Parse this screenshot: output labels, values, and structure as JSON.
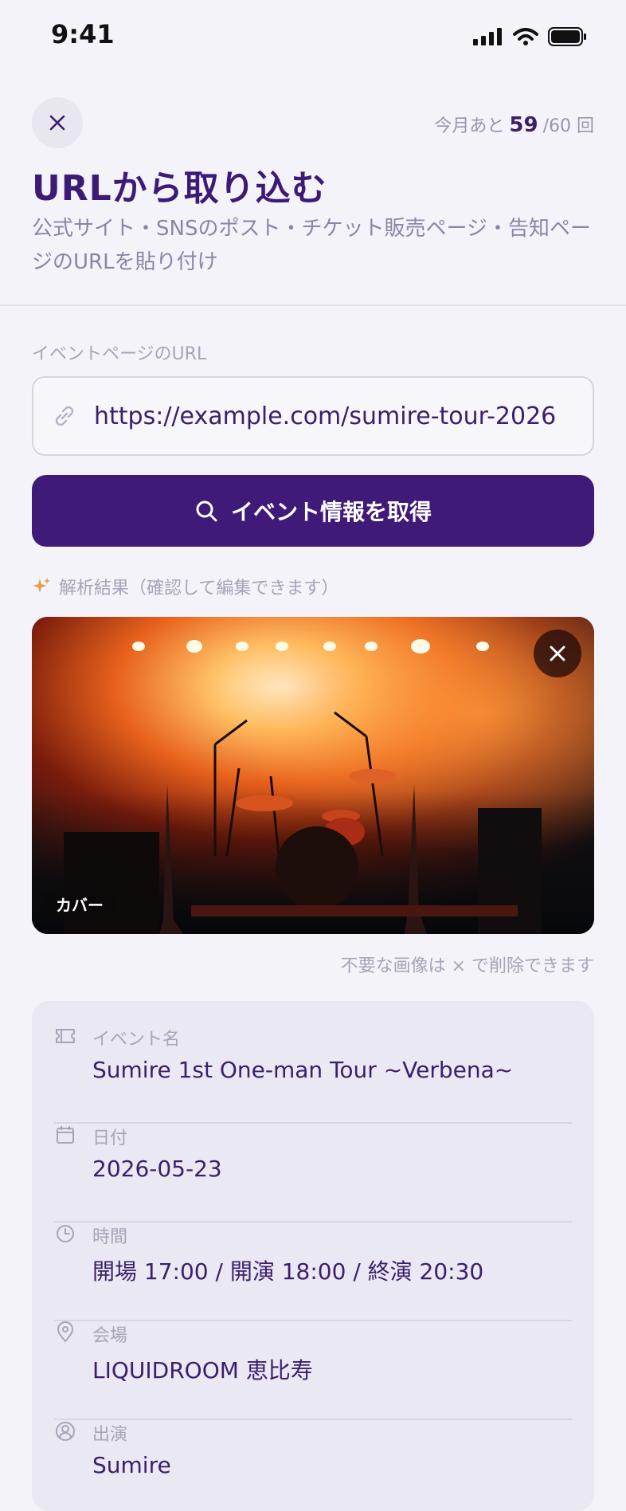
{
  "status_bar": {
    "time": "9:41"
  },
  "header": {
    "quota_prefix": "今月あと",
    "quota_remaining": "59",
    "quota_suffix": "/60 回",
    "title": "URLから取り込む",
    "subtitle": "公式サイト・SNSのポスト・チケット販売ページ・告知ページのURLを貼り付け"
  },
  "url_field": {
    "label": "イベントページのURL",
    "value": "https://example.com/sumire-tour-2026",
    "icon": "link-icon"
  },
  "fetch_button": {
    "label": "イベント情報を取得",
    "icon": "search-icon"
  },
  "result": {
    "label": "解析結果（確認して編集できます）",
    "image_badge": "カバー",
    "image_hint": "不要な画像は × で削除できます"
  },
  "details": [
    {
      "icon": "ticket-icon",
      "key": "イベント名",
      "value": "Sumire 1st One-man Tour ~Verbena~"
    },
    {
      "icon": "calendar-icon",
      "key": "日付",
      "value": "2026-05-23"
    },
    {
      "icon": "clock-icon",
      "key": "時間",
      "value": "開場 17:00 / 開演 18:00 / 終演 20:30"
    },
    {
      "icon": "location-pin-icon",
      "key": "会場",
      "value": "LIQUIDROOM 恵比寿"
    },
    {
      "icon": "performer-icon",
      "key": "出演",
      "value": "Sumire"
    }
  ],
  "colors": {
    "accent": "#3f1a78",
    "muted": "#a9a3b8",
    "background": "#f4f3f9"
  }
}
